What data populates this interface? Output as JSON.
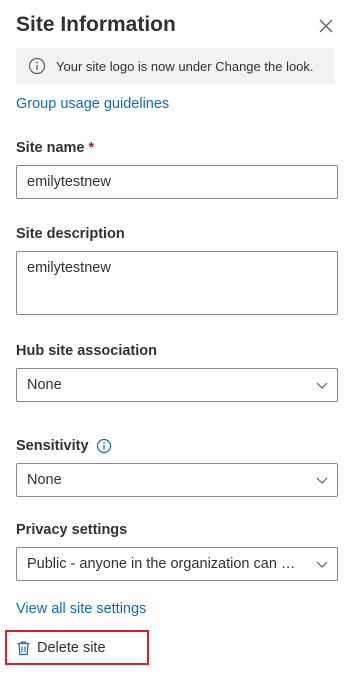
{
  "panel": {
    "title": "Site Information",
    "close_label": "Close"
  },
  "info_bar": {
    "message": "Your site logo is now under Change the look."
  },
  "links": {
    "group_usage": "Group usage guidelines",
    "view_all": "View all site settings"
  },
  "site_name": {
    "label": "Site name",
    "required_marker": "*",
    "value": "emilytestnew"
  },
  "site_description": {
    "label": "Site description",
    "value": "emilytestnew"
  },
  "hub_site": {
    "label": "Hub site association",
    "selected": "None"
  },
  "sensitivity": {
    "label": "Sensitivity",
    "selected": "None"
  },
  "privacy": {
    "label": "Privacy settings",
    "selected": "Public - anyone in the organization can access this site"
  },
  "delete": {
    "label": "Delete site"
  },
  "colors": {
    "link": "#0f6cbd",
    "info_bar_bg": "#f3f2f1",
    "highlight_border": "#d6202b",
    "required": "#a4262c"
  },
  "icons": {
    "close": "close-icon",
    "info": "info-icon",
    "chevron": "chevron-down-icon",
    "trash": "trash-icon"
  }
}
